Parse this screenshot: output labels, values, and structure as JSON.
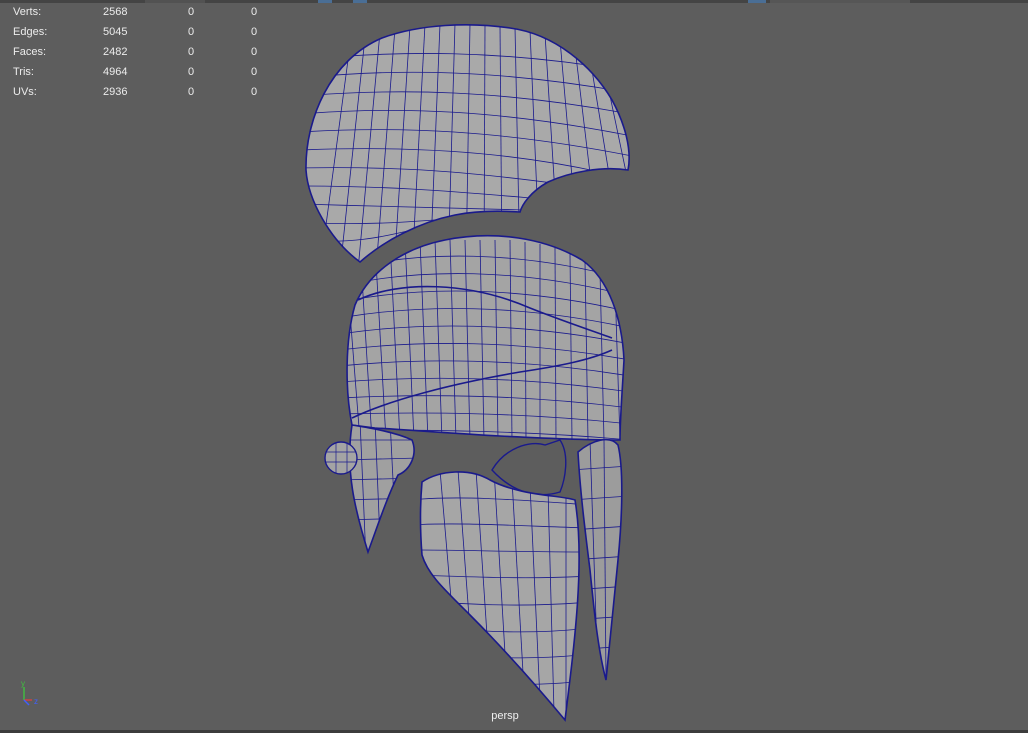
{
  "viewport": {
    "camera_label": "persp",
    "background_color": "#5d5d5d",
    "wireframe_color": "#1a1a8c",
    "shaded_color": "#a9a9a9"
  },
  "poly_count": {
    "rows": [
      {
        "label": "Verts:",
        "values": [
          "2568",
          "0",
          "0"
        ]
      },
      {
        "label": "Edges:",
        "values": [
          "5045",
          "0",
          "0"
        ]
      },
      {
        "label": "Faces:",
        "values": [
          "2482",
          "0",
          "0"
        ]
      },
      {
        "label": "Tris:",
        "values": [
          "4964",
          "0",
          "0"
        ]
      },
      {
        "label": "UVs:",
        "values": [
          "2936",
          "0",
          "0"
        ]
      }
    ]
  },
  "axis_gizmo": {
    "y_label": "y",
    "z_label": "z",
    "x_color": "#d94040",
    "y_color": "#40c040",
    "z_color": "#4060ff"
  },
  "scene_object": {
    "icon": "helmet-mesh-icon"
  }
}
